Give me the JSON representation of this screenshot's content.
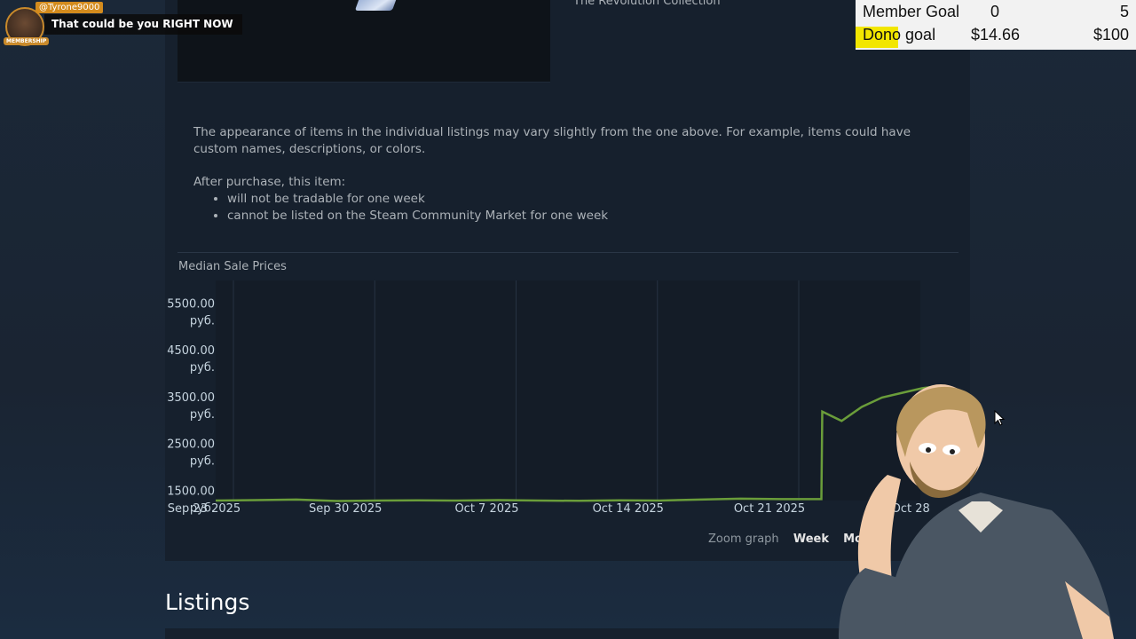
{
  "overlay": {
    "chat": {
      "username": "@Tyrone9000",
      "badge": "MEMBERSHIP",
      "message": "That could be you RIGHT NOW"
    },
    "goals": [
      {
        "label": "Member Goal",
        "current": "0",
        "target": "5"
      },
      {
        "label": "Dono goal",
        "current": "$14.66",
        "target": "$100"
      }
    ]
  },
  "item": {
    "collection": "The Revolution Collection",
    "description": "The appearance of items in the individual listings may vary slightly from the one above. For example, items could have custom names, descriptions, or colors.",
    "after_purchase_heading": "After purchase, this item:",
    "restrictions": [
      "will not be tradable for one week",
      "cannot be listed on the Steam Community Market for one week"
    ]
  },
  "chart_data": {
    "type": "line",
    "title": "Median Sale Prices",
    "y_ticks": [
      "5500.00 руб.",
      "4500.00 руб.",
      "3500.00 руб.",
      "2500.00 руб.",
      "1500.00 руб."
    ],
    "x_ticks": [
      "Sep 23 2025",
      "Sep 30 2025",
      "Oct 7 2025",
      "Oct 14 2025",
      "Oct 21 2025",
      "Oct 28"
    ],
    "ylim": [
      1300,
      6000
    ],
    "line_color": "#6a9d3a",
    "series": [
      {
        "x": [
          "2025-09-23",
          "2025-09-25",
          "2025-09-27",
          "2025-09-29",
          "2025-10-01",
          "2025-10-03",
          "2025-10-05",
          "2025-10-07",
          "2025-10-09",
          "2025-10-11",
          "2025-10-13",
          "2025-10-15",
          "2025-10-17",
          "2025-10-19",
          "2025-10-21",
          "2025-10-23",
          "2025-10-23",
          "2025-10-24",
          "2025-10-25",
          "2025-10-26",
          "2025-10-27",
          "2025-10-28",
          "2025-10-29"
        ],
        "y": [
          1300,
          1310,
          1320,
          1290,
          1300,
          1305,
          1300,
          1310,
          1300,
          1295,
          1305,
          1300,
          1320,
          1340,
          1330,
          1330,
          3200,
          3000,
          3300,
          3500,
          3600,
          3700,
          3750
        ]
      }
    ]
  },
  "zoom": {
    "label": "Zoom graph",
    "options": [
      "Week",
      "Mon"
    ]
  },
  "listings_heading": "Listings"
}
